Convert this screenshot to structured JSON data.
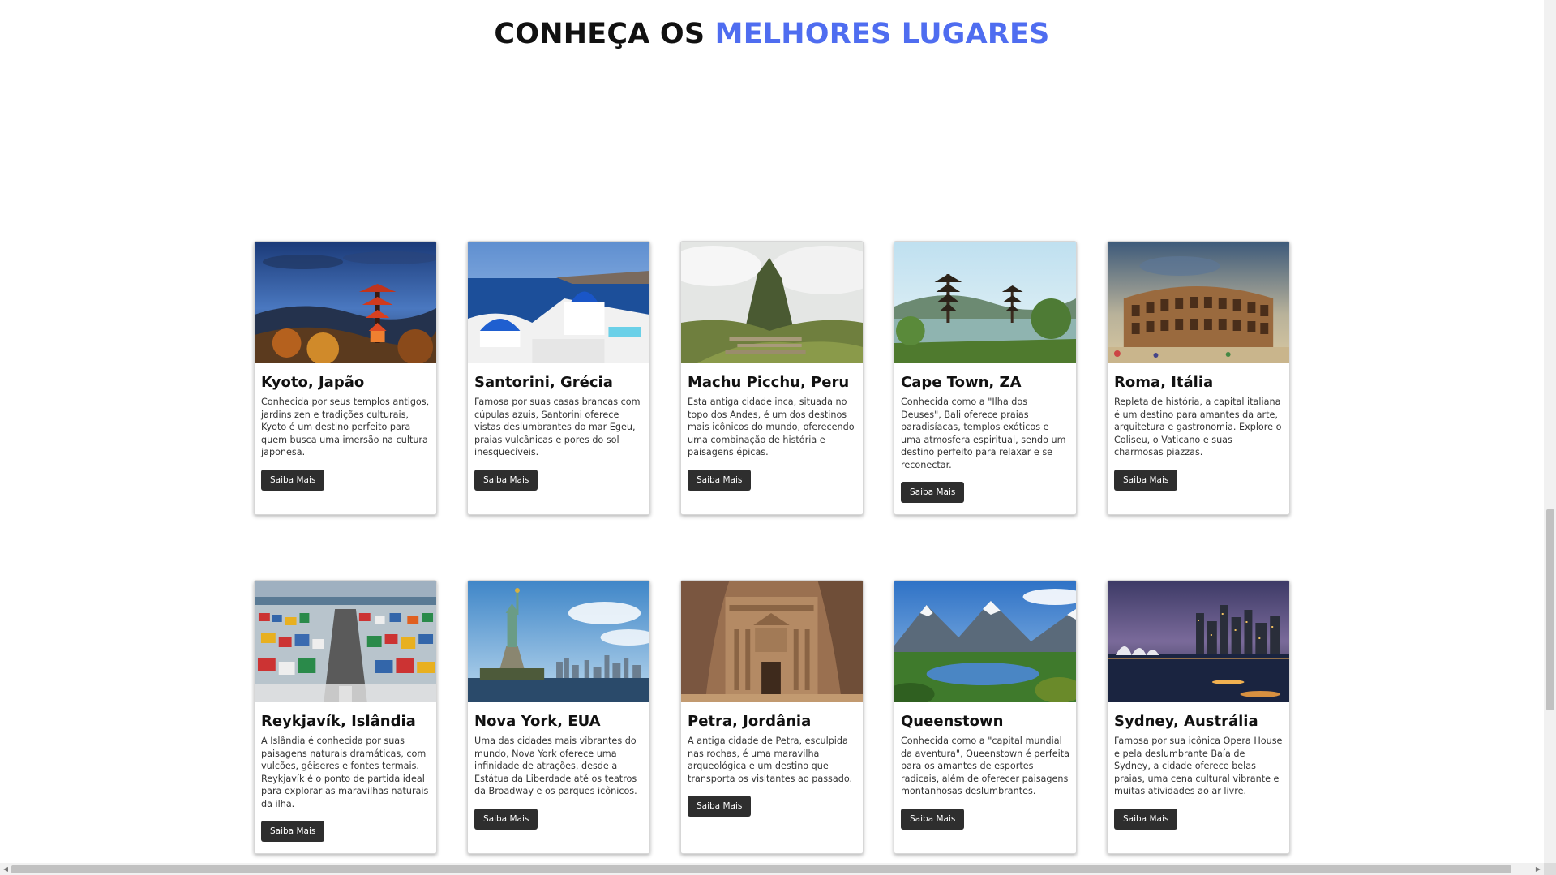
{
  "heading": {
    "part1": "CONHEÇA OS ",
    "part2": "MELHORES LUGARES",
    "accent_color": "#4f6df0"
  },
  "cards": [
    {
      "title": "Kyoto, Japão",
      "text": "Conhecida por seus templos antigos, jardins zen e tradições culturais, Kyoto é um destino perfeito para quem busca uma imersão na cultura japonesa.",
      "button": "Saiba Mais",
      "image": "kyoto-pagoda"
    },
    {
      "title": "Santorini, Grécia",
      "text": "Famosa por suas casas brancas com cúpulas azuis, Santorini oferece vistas deslumbrantes do mar Egeu, praias vulcânicas e pores do sol inesquecíveis.",
      "button": "Saiba Mais",
      "image": "santorini-domes"
    },
    {
      "title": "Machu Picchu, Peru",
      "text": "Esta antiga cidade inca, situada no topo dos Andes, é um dos destinos mais icônicos do mundo, oferecendo uma combinação de história e paisagens épicas.",
      "button": "Saiba Mais",
      "image": "machu-picchu"
    },
    {
      "title": "Cape Town, ZA",
      "text": "Conhecida como a \"Ilha dos Deuses\", Bali oferece praias paradisíacas, templos exóticos e uma atmosfera espiritual, sendo um destino perfeito para relaxar e se reconectar.",
      "button": "Saiba Mais",
      "image": "bali-temple"
    },
    {
      "title": "Roma, Itália",
      "text": "Repleta de história, a capital italiana é um destino para amantes da arte, arquitetura e gastronomia. Explore o Coliseu, o Vaticano e suas charmosas piazzas.",
      "button": "Saiba Mais",
      "image": "colosseum"
    },
    {
      "title": "Reykjavík, Islândia",
      "text": "A Islândia é conhecida por suas paisagens naturais dramáticas, com vulcões, gêiseres e fontes termais. Reykjavík é o ponto de partida ideal para explorar as maravilhas naturais da ilha.",
      "button": "Saiba Mais",
      "image": "reykjavik-rooftops"
    },
    {
      "title": "Nova York, EUA",
      "text": "Uma das cidades mais vibrantes do mundo, Nova York oferece uma infinidade de atrações, desde a Estátua da Liberdade até os teatros da Broadway e os parques icônicos.",
      "button": "Saiba Mais",
      "image": "statue-of-liberty"
    },
    {
      "title": "Petra, Jordânia",
      "text": "A antiga cidade de Petra, esculpida nas rochas, é uma maravilha arqueológica e um destino que transporta os visitantes ao passado.",
      "button": "Saiba Mais",
      "image": "petra-monastery"
    },
    {
      "title": "Queenstown",
      "text": "Conhecida como a \"capital mundial da aventura\", Queenstown é perfeita para os amantes de esportes radicais, além de oferecer paisagens montanhosas deslumbrantes.",
      "button": "Saiba Mais",
      "image": "queenstown-mountains"
    },
    {
      "title": "Sydney, Austrália",
      "text": "Famosa por sua icônica Opera House e pela deslumbrante Baía de Sydney, a cidade oferece belas praias, uma cena cultural vibrante e muitas atividades ao ar livre.",
      "button": "Saiba Mais",
      "image": "sydney-harbour-night"
    }
  ]
}
